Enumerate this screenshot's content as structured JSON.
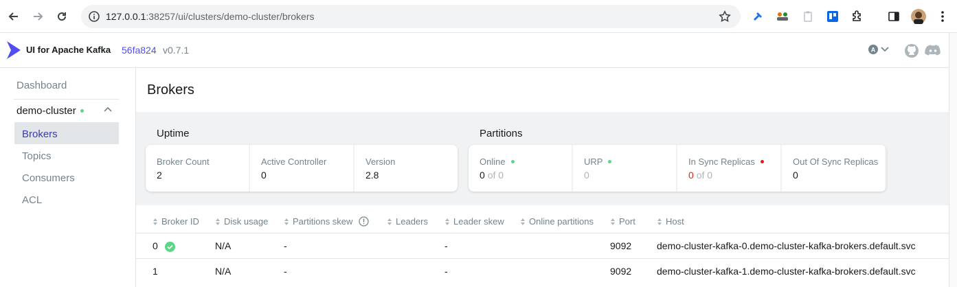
{
  "browser": {
    "url_host": "127.0.0.1",
    "url_path": ":38257/ui/clusters/demo-cluster/brokers"
  },
  "header": {
    "brand": "UI for Apache Kafka",
    "commit": "56fa824",
    "version": "v0.7.1",
    "theme_badge": "A"
  },
  "sidebar": {
    "dashboard": "Dashboard",
    "cluster_name": "demo-cluster",
    "items": [
      {
        "label": "Brokers"
      },
      {
        "label": "Topics"
      },
      {
        "label": "Consumers"
      },
      {
        "label": "ACL"
      }
    ]
  },
  "page": {
    "title": "Brokers"
  },
  "uptime": {
    "title": "Uptime",
    "broker_count_label": "Broker Count",
    "broker_count": "2",
    "active_controller_label": "Active Controller",
    "active_controller": "0",
    "version_label": "Version",
    "version": "2.8"
  },
  "partitions": {
    "title": "Partitions",
    "online_label": "Online",
    "online_value": "0",
    "online_of": "of 0",
    "urp_label": "URP",
    "urp_value": "0",
    "isr_label": "In Sync Replicas",
    "isr_value": "0",
    "isr_of": "of 0",
    "oosr_label": "Out Of Sync Replicas",
    "oosr_value": "0"
  },
  "table": {
    "headers": {
      "broker_id": "Broker ID",
      "disk_usage": "Disk usage",
      "partitions_skew": "Partitions skew",
      "leaders": "Leaders",
      "leader_skew": "Leader skew",
      "online_partitions": "Online partitions",
      "port": "Port",
      "host": "Host"
    },
    "rows": [
      {
        "broker_id": "0",
        "disk_usage": "N/A",
        "partitions_skew": "-",
        "leader_skew": "-",
        "port": "9092",
        "host": "demo-cluster-kafka-0.demo-cluster-kafka-brokers.default.svc"
      },
      {
        "broker_id": "1",
        "disk_usage": "N/A",
        "partitions_skew": "-",
        "leader_skew": "-",
        "port": "9092",
        "host": "demo-cluster-kafka-1.demo-cluster-kafka-brokers.default.svc"
      }
    ]
  },
  "colors": {
    "accent": "#4f4ff0",
    "status_ok": "#5cd685",
    "status_error": "#e51a1a"
  }
}
